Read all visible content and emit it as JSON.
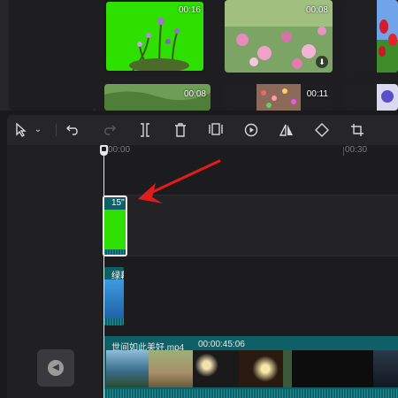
{
  "media": {
    "thumbnails": [
      {
        "id": "flowers-green",
        "duration": "00:16",
        "download": false
      },
      {
        "id": "pink-cosmos",
        "duration": "00:08",
        "download": true
      },
      {
        "id": "red-tulips",
        "duration": "",
        "download": false
      },
      {
        "id": "green-grass",
        "duration": "00:08",
        "download": false
      },
      {
        "id": "flower-field",
        "duration": "00:11",
        "download": false
      },
      {
        "id": "purple-flower",
        "duration": "",
        "download": false
      }
    ],
    "download_icon": "download-icon"
  },
  "toolbar": {
    "tools": [
      "select-arrow-icon",
      "dropdown-chevron-icon",
      "undo-icon",
      "redo-icon",
      "split-icon",
      "delete-icon",
      "freeze-icon",
      "play-reverse-icon",
      "mirror-icon",
      "rotate-icon",
      "crop-icon"
    ]
  },
  "timeline": {
    "ruler": {
      "start": "00:00",
      "mark": "00:30"
    },
    "overlay_clip": {
      "label": "15\""
    },
    "text_clip": {
      "label": "绿幕"
    },
    "main_clip": {
      "name": "世间如此美好.mp4",
      "duration": "00:00:45:06"
    },
    "audio_button_icon": "speaker-icon"
  },
  "colors": {
    "accent": "#0e5f66",
    "green_screen": "#2de000",
    "arrow": "#e21b1b"
  }
}
